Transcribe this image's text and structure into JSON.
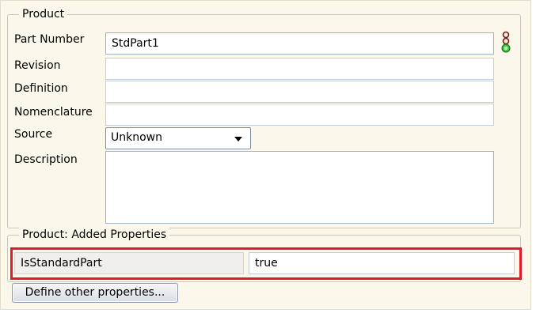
{
  "product_group": {
    "title": "Product",
    "part_number": {
      "label": "Part Number",
      "value": "StdPart1"
    },
    "revision": {
      "label": "Revision",
      "value": ""
    },
    "definition": {
      "label": "Definition",
      "value": ""
    },
    "nomenclature": {
      "label": "Nomenclature",
      "value": ""
    },
    "source": {
      "label": "Source",
      "selected": "Unknown"
    },
    "description": {
      "label": "Description",
      "value": ""
    },
    "status_icon": "traffic-light-green-icon"
  },
  "added_properties_group": {
    "title": "Product: Added Properties",
    "properties": [
      {
        "name": "IsStandardPart",
        "value": "true"
      }
    ]
  },
  "define_button_label": "Define other properties...",
  "colors": {
    "panel_background": "#fbf7ea",
    "highlight_border": "#e11b2a",
    "status_green": "#3cc23c"
  }
}
